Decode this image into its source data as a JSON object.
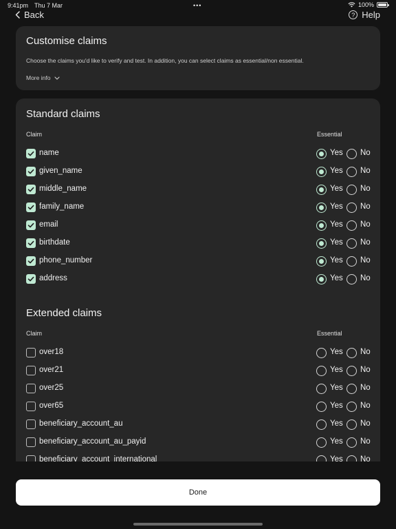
{
  "status_bar": {
    "time": "9:41pm",
    "date": "Thu 7 Mar",
    "dots": "•••",
    "battery": "100%",
    "battery_level": 1.0
  },
  "nav": {
    "back_label": "Back",
    "help_label": "Help",
    "help_glyph": "?"
  },
  "intro": {
    "title": "Customise claims",
    "description": "Choose the claims you'd like to verify and test. In addition, you can select claims as essential/non essential.",
    "more_info": "More info"
  },
  "standard": {
    "title": "Standard claims",
    "col_claim": "Claim",
    "col_essential": "Essential",
    "yes_label": "Yes",
    "no_label": "No",
    "claims": [
      {
        "label": "name",
        "checked": true,
        "essential": "yes"
      },
      {
        "label": "given_name",
        "checked": true,
        "essential": "yes"
      },
      {
        "label": "middle_name",
        "checked": true,
        "essential": "yes"
      },
      {
        "label": "family_name",
        "checked": true,
        "essential": "yes"
      },
      {
        "label": "email",
        "checked": true,
        "essential": "yes"
      },
      {
        "label": "birthdate",
        "checked": true,
        "essential": "yes"
      },
      {
        "label": "phone_number",
        "checked": true,
        "essential": "yes"
      },
      {
        "label": "address",
        "checked": true,
        "essential": "yes"
      }
    ]
  },
  "extended": {
    "title": "Extended claims",
    "col_claim": "Claim",
    "col_essential": "Essential",
    "yes_label": "Yes",
    "no_label": "No",
    "claims": [
      {
        "label": "over18",
        "checked": false,
        "essential": "none"
      },
      {
        "label": "over21",
        "checked": false,
        "essential": "none"
      },
      {
        "label": "over25",
        "checked": false,
        "essential": "none"
      },
      {
        "label": "over65",
        "checked": false,
        "essential": "none"
      },
      {
        "label": "beneficiary_account_au",
        "checked": false,
        "essential": "none"
      },
      {
        "label": "beneficiary_account_au_payid",
        "checked": false,
        "essential": "none"
      },
      {
        "label": "beneficiary_account_international",
        "checked": false,
        "essential": "none"
      }
    ]
  },
  "footer": {
    "done_label": "Done"
  },
  "colors": {
    "background": "#141414",
    "card": "#272727",
    "accent": "#bfe9d2",
    "button": "#ffffff"
  },
  "icons": {
    "back": "chevron-left-icon",
    "help": "question-circle-icon",
    "more_info": "chevron-down-icon",
    "wifi": "wifi-icon",
    "battery": "battery-icon",
    "check": "checkmark-icon"
  }
}
